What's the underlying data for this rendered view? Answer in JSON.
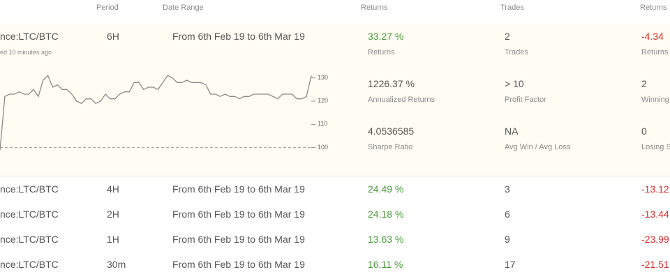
{
  "headers": {
    "period": "Period",
    "date_range": "Date Range",
    "returns": "Returns",
    "trades": "Trades",
    "returns_right": "Returns"
  },
  "expanded_row": {
    "market": "nce:LTC/BTC",
    "updated": "ed 10 minutes ago",
    "period": "6H",
    "date_range": "From 6th Feb 19 to 6th Mar 19",
    "stats": {
      "returns_value": "33.27 %",
      "returns_label": "Returns",
      "annualized_value": "1226.37 %",
      "annualized_label": "Annualized Returns",
      "sharpe_value": "4.0536585",
      "sharpe_label": "Sharpe Ratio",
      "trades_value": "2",
      "trades_label": "Trades",
      "profit_factor_value": "> 10",
      "profit_factor_label": "Profit Factor",
      "avgwin_value": "NA",
      "avgwin_label": "Avg Win / Avg Loss",
      "right_returns_value": "-4.34",
      "right_returns_label": "Returns",
      "winning_value": "2",
      "winning_label": "Winning",
      "losing_value": "0",
      "losing_label": "Losing S"
    },
    "chart_data": {
      "type": "line",
      "y_ticks": [
        "130",
        "120",
        "110",
        "100"
      ],
      "ylim": [
        93,
        138
      ],
      "baseline": 100,
      "values": [
        99,
        122,
        123,
        123,
        124,
        123,
        123,
        125,
        122,
        129,
        131,
        126,
        127,
        125,
        125,
        123,
        120,
        119,
        121,
        121,
        119,
        120,
        123,
        121,
        121,
        123,
        124,
        124,
        128,
        128,
        125,
        126,
        126,
        125,
        128,
        131,
        130,
        128,
        128,
        129,
        128,
        128,
        128,
        127,
        123,
        123,
        122,
        123,
        122,
        122,
        121,
        122,
        122,
        123,
        123,
        123,
        123,
        122,
        121,
        123,
        123,
        123,
        121,
        121,
        122,
        131
      ],
      "line_color": "#8a8a8a"
    }
  },
  "rows": [
    {
      "market": "nce:LTC/BTC",
      "period": "4H",
      "date_range": "From 6th Feb 19 to 6th Mar 19",
      "returns": "24.49 %",
      "trades": "3",
      "right_returns": "-13.12"
    },
    {
      "market": "nce:LTC/BTC",
      "period": "2H",
      "date_range": "From 6th Feb 19 to 6th Mar 19",
      "returns": "24.18 %",
      "trades": "6",
      "right_returns": "-13.44"
    },
    {
      "market": "nce:LTC/BTC",
      "period": "1H",
      "date_range": "From 6th Feb 19 to 6th Mar 19",
      "returns": "13.63 %",
      "trades": "9",
      "right_returns": "-23.99"
    },
    {
      "market": "nce:LTC/BTC",
      "period": "30m",
      "date_range": "From 6th Feb 19 to 6th Mar 19",
      "returns": "16.11 %",
      "trades": "17",
      "right_returns": "-21.51"
    }
  ]
}
